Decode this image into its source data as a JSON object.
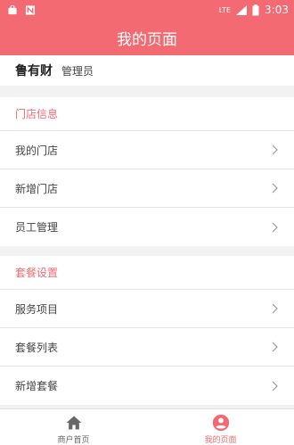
{
  "status_bar": {
    "time": "3:03",
    "network": "LTE",
    "colors": {
      "bar": "#f36a72"
    }
  },
  "header": {
    "title": "我的页面"
  },
  "user": {
    "name": "鲁有财",
    "role": "管理员"
  },
  "sections": [
    {
      "title": "门店信息",
      "items": [
        "我的门店",
        "新增门店",
        "员工管理"
      ]
    },
    {
      "title": "套餐设置",
      "items": [
        "服务项目",
        "套餐列表",
        "新增套餐"
      ]
    }
  ],
  "tabs": [
    {
      "label": "商户首页",
      "icon": "home-icon",
      "active": false
    },
    {
      "label": "我的页面",
      "icon": "user-circle-icon",
      "active": true
    }
  ],
  "colors": {
    "accent": "#f36a72",
    "background": "#f2f2f2"
  }
}
